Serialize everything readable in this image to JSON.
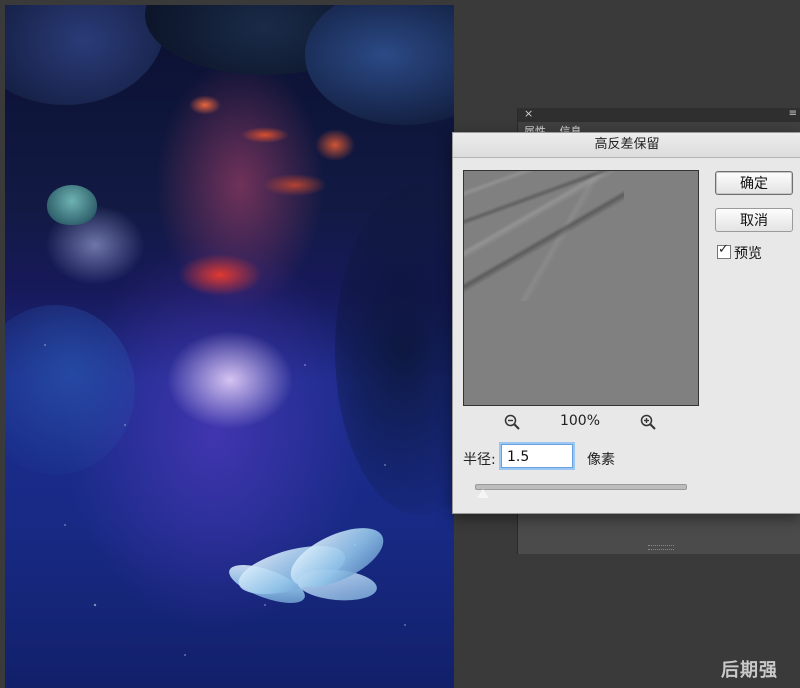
{
  "background_panel": {
    "tabs": [
      "属性",
      "信息"
    ]
  },
  "dialog": {
    "title": "高反差保留",
    "zoom": "100%",
    "radius_label": "半径:",
    "radius_value": "1.5",
    "radius_unit": "像素",
    "radius_slider_fraction": 0.04,
    "ok_label": "确定",
    "cancel_label": "取消",
    "preview_label": "预览",
    "preview_checked": true
  },
  "watermark": "后期强"
}
